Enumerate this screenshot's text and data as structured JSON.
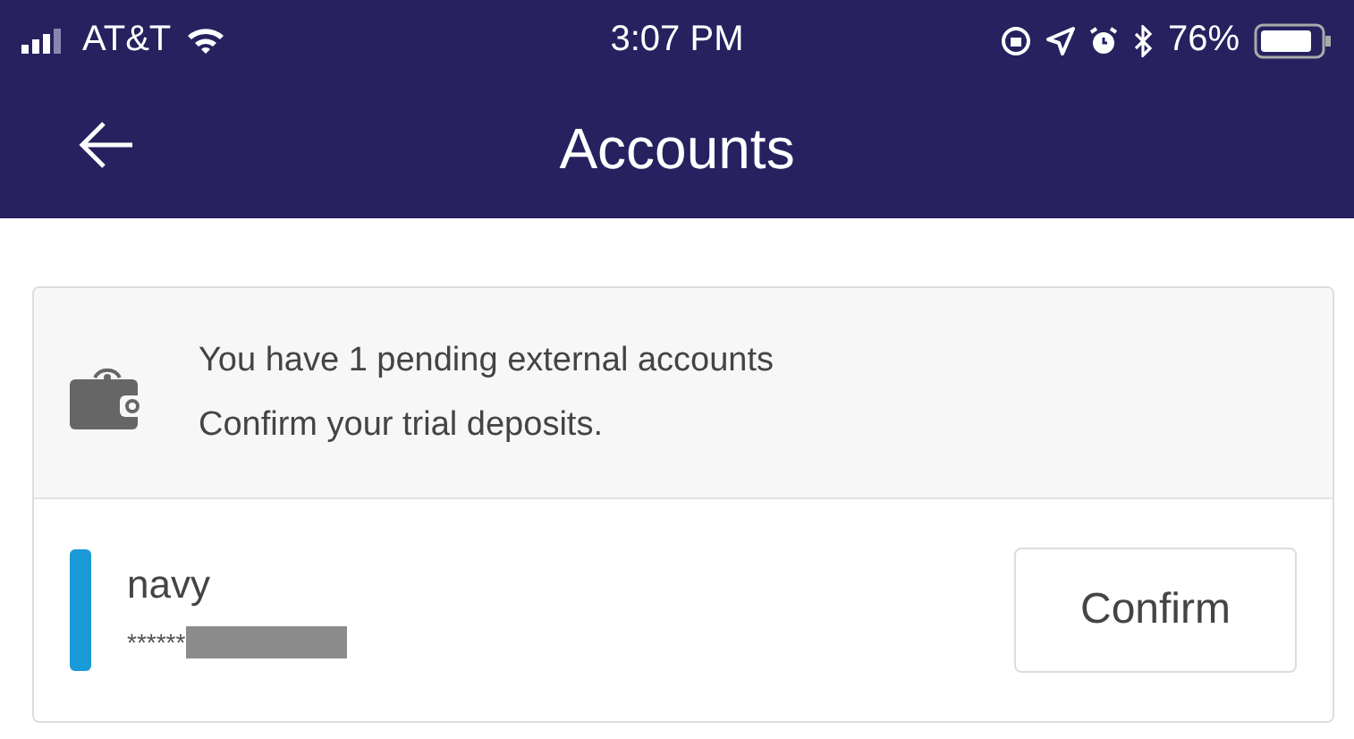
{
  "status_bar": {
    "carrier": "AT&T",
    "time": "3:07 PM",
    "battery": "76%"
  },
  "header": {
    "title": "Accounts"
  },
  "notice": {
    "lines": [
      "You have 1 pending external accounts",
      "Confirm your trial deposits."
    ]
  },
  "accounts": [
    {
      "name": "navy",
      "number": "******",
      "color": "#1a9ad6",
      "button": "Confirm"
    }
  ]
}
